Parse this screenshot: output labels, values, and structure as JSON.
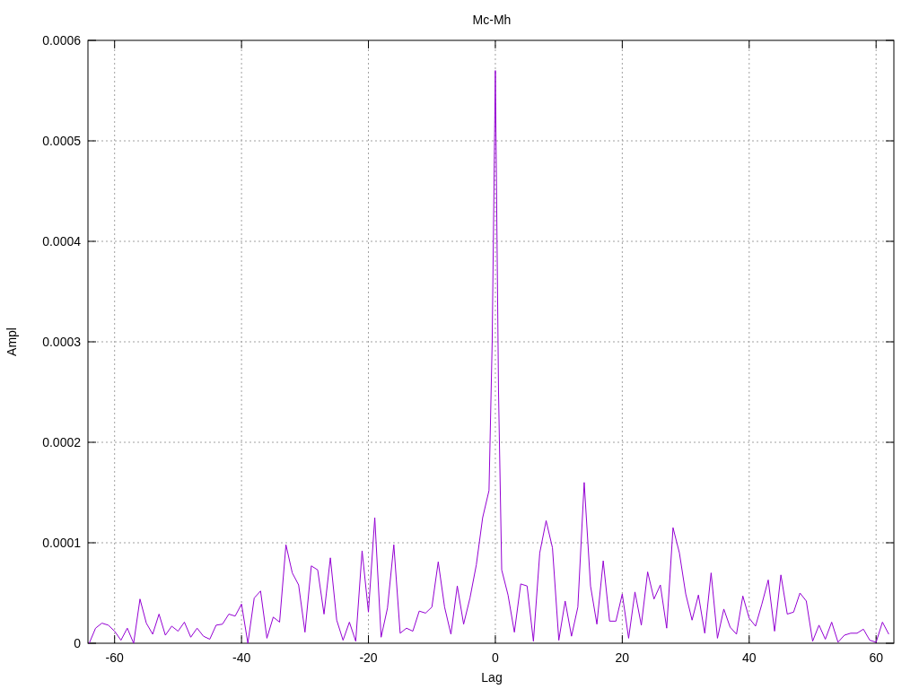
{
  "chart_data": {
    "type": "line",
    "title": "Mc-Mh",
    "xlabel": "Lag",
    "ylabel": "Ampl",
    "x": [
      -64,
      -63,
      -62,
      -61,
      -60,
      -59,
      -58,
      -57,
      -56,
      -55,
      -54,
      -53,
      -52,
      -51,
      -50,
      -49,
      -48,
      -47,
      -46,
      -45,
      -44,
      -43,
      -42,
      -41,
      -40,
      -39,
      -38,
      -37,
      -36,
      -35,
      -34,
      -33,
      -32,
      -31,
      -30,
      -29,
      -28,
      -27,
      -26,
      -25,
      -24,
      -23,
      -22,
      -21,
      -20,
      -19,
      -18,
      -17,
      -16,
      -15,
      -14,
      -13,
      -12,
      -11,
      -10,
      -9,
      -8,
      -7,
      -6,
      -5,
      -4,
      -3,
      -2,
      -1,
      -0.5,
      0,
      0.5,
      1,
      2,
      3,
      4,
      5,
      6,
      7,
      8,
      9,
      10,
      11,
      12,
      13,
      14,
      15,
      16,
      17,
      18,
      19,
      20,
      21,
      22,
      23,
      24,
      25,
      26,
      27,
      28,
      29,
      30,
      31,
      32,
      33,
      34,
      35,
      36,
      37,
      38,
      39,
      40,
      41,
      42,
      43,
      44,
      45,
      46,
      47,
      48,
      49,
      50,
      51,
      52,
      53,
      54,
      55,
      56,
      57,
      58,
      59,
      60,
      61,
      62
    ],
    "series": [
      {
        "color": "#9400d3",
        "values": [
          0,
          1.5e-05,
          2e-05,
          1.8e-05,
          1.2e-05,
          3e-06,
          1.5e-05,
          0,
          4.4e-05,
          2e-05,
          9e-06,
          2.9e-05,
          8e-06,
          1.7e-05,
          1.2e-05,
          2.1e-05,
          6e-06,
          1.5e-05,
          7e-06,
          4e-06,
          1.8e-05,
          1.9e-05,
          2.9e-05,
          2.7e-05,
          3.9e-05,
          0,
          4.5e-05,
          5.2e-05,
          5e-06,
          2.6e-05,
          2.1e-05,
          9.8e-05,
          7e-05,
          5.8e-05,
          1.1e-05,
          7.7e-05,
          7.3e-05,
          2.9e-05,
          8.5e-05,
          2.3e-05,
          3e-06,
          2.1e-05,
          2e-06,
          9.2e-05,
          3.1e-05,
          0.000125,
          6e-06,
          3.5e-05,
          9.8e-05,
          1e-05,
          1.5e-05,
          1.2e-05,
          3.2e-05,
          3e-05,
          3.6e-05,
          8.1e-05,
          3.6e-05,
          9e-06,
          5.7e-05,
          1.9e-05,
          4.5e-05,
          7.8e-05,
          0.000125,
          0.000152,
          0.0003,
          0.00057,
          0.00025,
          7.3e-05,
          4.8e-05,
          1.1e-05,
          5.9e-05,
          5.7e-05,
          2e-06,
          9e-05,
          0.000122,
          9.5e-05,
          3e-06,
          4.2e-05,
          7e-06,
          3.6e-05,
          0.00016,
          5.7e-05,
          1.9e-05,
          8.2e-05,
          2.2e-05,
          2.2e-05,
          4.9e-05,
          5e-06,
          5.1e-05,
          1.8e-05,
          7.1e-05,
          4.4e-05,
          5.8e-05,
          1.5e-05,
          0.000115,
          9e-05,
          4.9e-05,
          2.3e-05,
          4.8e-05,
          1e-05,
          7e-05,
          5e-06,
          3.4e-05,
          1.6e-05,
          9e-06,
          4.7e-05,
          2.5e-05,
          1.7e-05,
          3.9e-05,
          6.3e-05,
          1.2e-05,
          6.8e-05,
          2.9e-05,
          3.1e-05,
          5e-05,
          4.2e-05,
          2e-06,
          1.8e-05,
          4e-06,
          2.1e-05,
          1e-06,
          8e-06,
          1e-05,
          1e-05,
          1.4e-05,
          3e-06,
          1e-06,
          2.1e-05,
          9e-06
        ]
      }
    ],
    "xlim": [
      -64.2,
      62.8
    ],
    "ylim": [
      0,
      0.0006
    ],
    "xticks": [
      -60,
      -40,
      -20,
      0,
      20,
      40,
      60
    ],
    "yticks": [
      0,
      0.0001,
      0.0002,
      0.0003,
      0.0004,
      0.0005,
      0.0006
    ],
    "grid": true
  }
}
